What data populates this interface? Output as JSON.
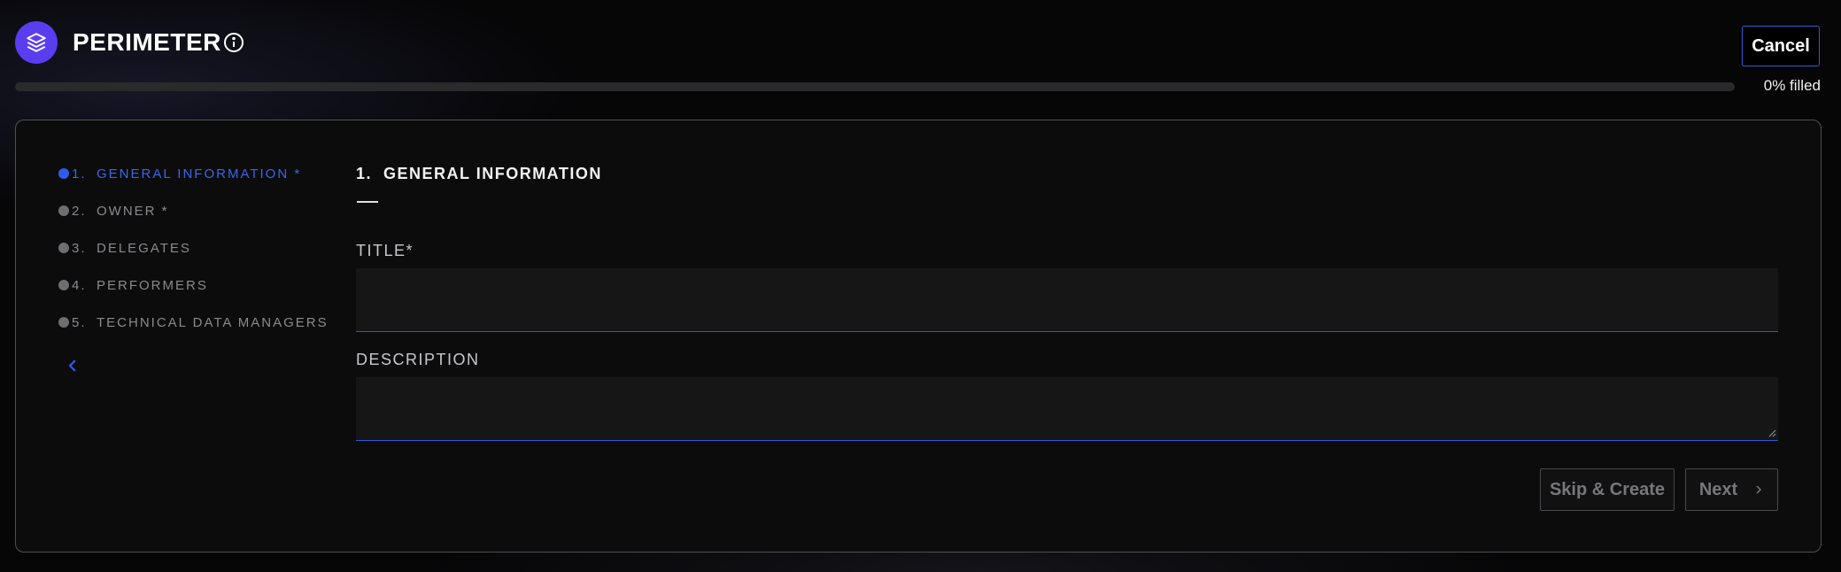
{
  "header": {
    "app_title": "PERIMETER",
    "cancel_label": "Cancel",
    "progress_text": "0% filled",
    "progress_fraction": 0
  },
  "steps": [
    {
      "number": "1.",
      "label": "GENERAL INFORMATION *",
      "active": true
    },
    {
      "number": "2.",
      "label": "OWNER *",
      "active": false
    },
    {
      "number": "3.",
      "label": "DELEGATES",
      "active": false
    },
    {
      "number": "4.",
      "label": "PERFORMERS",
      "active": false
    },
    {
      "number": "5.",
      "label": "TECHNICAL DATA MANAGERS",
      "active": false
    }
  ],
  "form": {
    "section_title": "1.  GENERAL INFORMATION",
    "title_label": "TITLE*",
    "title_value": "",
    "description_label": "DESCRIPTION",
    "description_value": ""
  },
  "actions": {
    "skip_label": "Skip & Create",
    "next_label": "Next"
  },
  "colors": {
    "accent": "#2f5be8",
    "logo": "#5b3df0",
    "background": "#060607"
  },
  "icons": {
    "logo": "layers-icon",
    "info": "info-icon",
    "collapse": "chevron-left-icon",
    "next": "chevron-right-icon"
  }
}
